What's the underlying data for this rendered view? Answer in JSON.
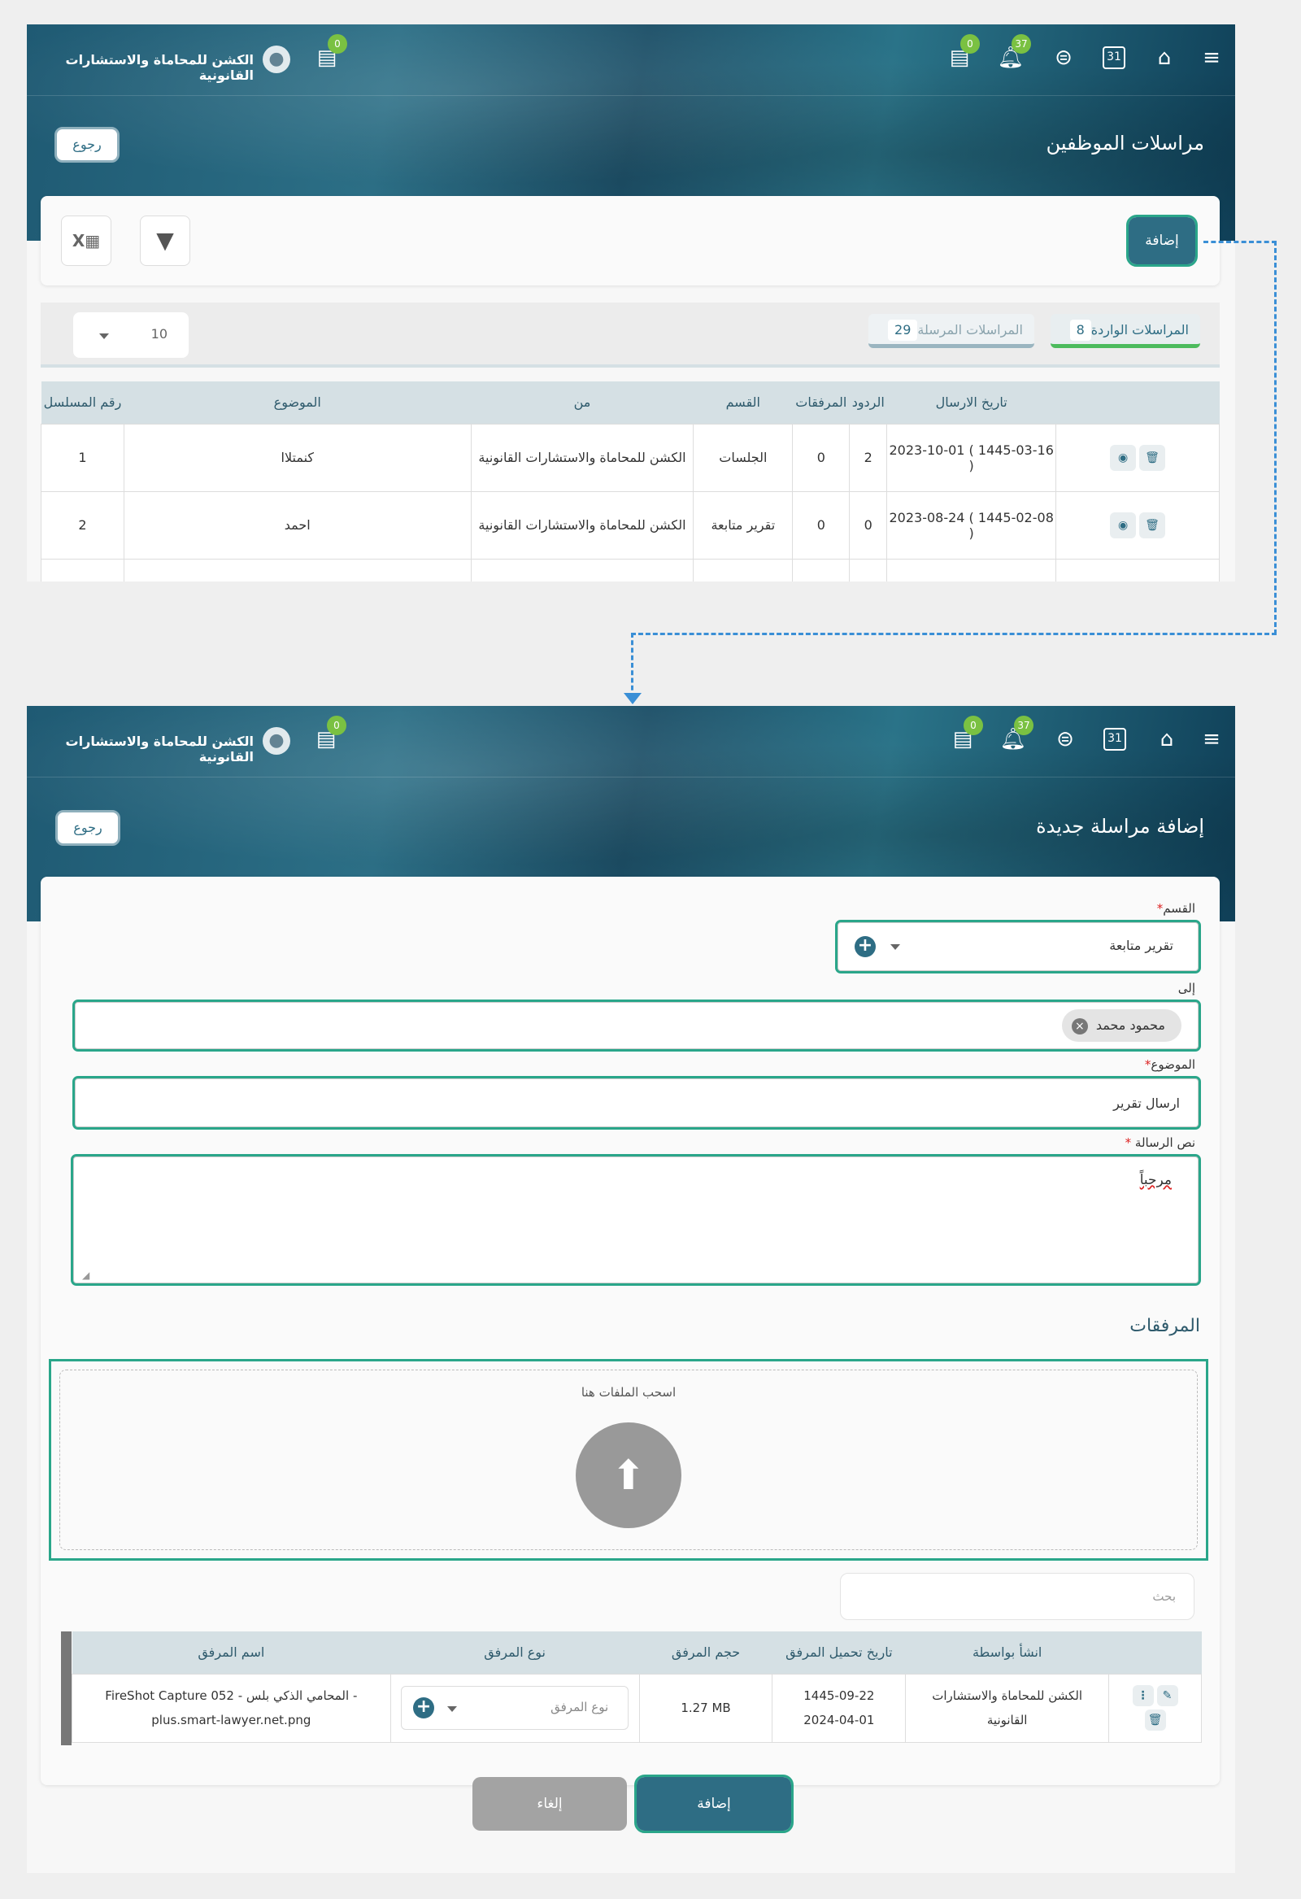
{
  "top": {
    "company": "الكشن للمحاماة والاستشارات القانونية",
    "chat_badge": "0",
    "messages_badge": "0",
    "notifications_badge": "37",
    "calendar_day": "31"
  },
  "list_screen": {
    "title": "مراسلات الموظفين",
    "back": "رجوع",
    "add": "إضافة",
    "tabs": [
      {
        "label": "المراسلات الواردة",
        "count": "8"
      },
      {
        "label": "المراسلات المرسلة",
        "count": "29"
      }
    ],
    "page_size": "10",
    "columns": [
      "رقم المسلسل",
      "الموضوع",
      "من",
      "القسم",
      "المرفقات",
      "الردود",
      "تاريخ الارسال"
    ],
    "rows": [
      [
        "1",
        "كنمتلاا",
        "الكشن للمحاماة والاستشارات القانونية",
        "الجلسات",
        "0",
        "2",
        "2023-10-01 ( 1445-03-16 )"
      ],
      [
        "2",
        "احمد",
        "الكشن للمحاماة والاستشارات القانونية",
        "تقرير متابعة",
        "0",
        "0",
        "2023-08-24 ( 1445-02-08 )"
      ]
    ]
  },
  "form_screen": {
    "title": "إضافة مراسلة جديدة",
    "back": "رجوع",
    "department_label": "القسم",
    "department_value": "تقرير متابعة",
    "to_label": "إلى",
    "to_chip": "محمود محمد",
    "subject_label": "الموضوع",
    "subject_value": "ارسال تقرير",
    "body_label": "نص الرسالة",
    "body_value": "مرحباً",
    "attachments_title": "المرفقات",
    "drop_text": "اسحب الملفات هنا",
    "search_placeholder": "بحث",
    "att_columns": [
      "اسم المرفق",
      "نوع المرفق",
      "حجم المرفق",
      "تاريخ تحميل المرفق",
      "انشأ بواسطة"
    ],
    "att_row": {
      "name": "FireShot Capture 052 - المحامي الذكي بلس - plus.smart-lawyer.net.png",
      "type_placeholder": "نوع المرفق",
      "size": "1.27 MB",
      "date_hijri": "1445-09-22",
      "date_greg": "2024-04-01",
      "created_by": "الكشن للمحاماة والاستشارات القانونية"
    },
    "submit": "إضافة",
    "cancel": "إلغاء"
  },
  "colors": {
    "primary": "#2e6d84",
    "highlight": "#2aa68a",
    "badge": "#7ac142",
    "connector": "#3a8fd6"
  }
}
